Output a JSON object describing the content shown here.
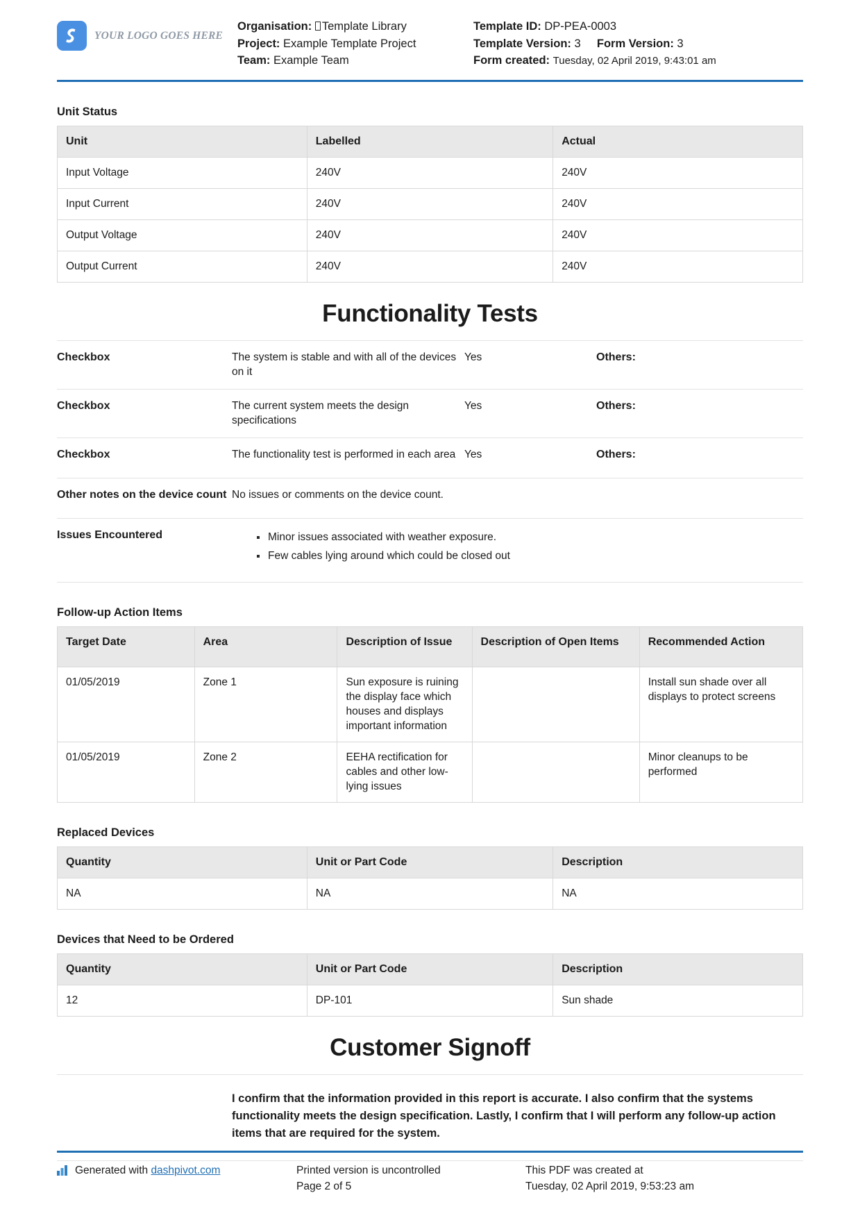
{
  "brand": {
    "accent": "#1f6fb5",
    "logo_blue": "#4a90e2",
    "logo_text": "YOUR LOGO GOES HERE"
  },
  "header": {
    "left": [
      {
        "label": "Organisation:",
        "value": "Template Library",
        "tofu": true
      },
      {
        "label": "Project:",
        "value": "Example Template Project"
      },
      {
        "label": "Team:",
        "value": "Example Team"
      }
    ],
    "right": [
      {
        "label": "Template ID:",
        "value": "DP-PEA-0003"
      },
      {
        "label": "Template Version:",
        "value": "3",
        "label2": "Form Version:",
        "value2": "3"
      },
      {
        "label": "Form created:",
        "value": "Tuesday, 02 April 2019, 9:43:01 am"
      }
    ]
  },
  "unit_status": {
    "section_label": "Unit Status",
    "columns": [
      "Unit",
      "Labelled",
      "Actual"
    ],
    "rows": [
      [
        "Input Voltage",
        "240V",
        "240V"
      ],
      [
        "Input Current",
        "240V",
        "240V"
      ],
      [
        "Output Voltage",
        "240V",
        "240V"
      ],
      [
        "Output Current",
        "240V",
        "240V"
      ]
    ]
  },
  "functionality": {
    "title": "Functionality Tests",
    "checks": [
      {
        "label": "Checkbox",
        "description": "The system is stable and with all of the devices on it",
        "answer": "Yes",
        "others": "Others:"
      },
      {
        "label": "Checkbox",
        "description": "The current system meets the design specifications",
        "answer": "Yes",
        "others": "Others:"
      },
      {
        "label": "Checkbox",
        "description": "The functionality test is performed in each area",
        "answer": "Yes",
        "others": "Others:"
      }
    ],
    "notes": {
      "label": "Other notes on the device count",
      "value": "No issues or comments on the device count."
    },
    "issues": {
      "label": "Issues Encountered",
      "items": [
        "Minor issues associated with weather exposure.",
        "Few cables lying around which could be closed out"
      ]
    }
  },
  "follow_up": {
    "section_label": "Follow-up Action Items",
    "columns": [
      "Target Date",
      "Area",
      "Description of Issue",
      "Description of Open Items",
      "Recommended Action"
    ],
    "rows": [
      [
        "01/05/2019",
        "Zone 1",
        "Sun exposure is ruining the display face which houses and displays important information",
        "",
        "Install sun shade over all displays to protect screens"
      ],
      [
        "01/05/2019",
        "Zone 2",
        "EEHA rectification for cables and other low-lying issues",
        "",
        "Minor cleanups to be performed"
      ]
    ]
  },
  "replaced_devices": {
    "section_label": "Replaced Devices",
    "columns": [
      "Quantity",
      "Unit or Part Code",
      "Description"
    ],
    "rows": [
      [
        "NA",
        "NA",
        "NA"
      ]
    ]
  },
  "devices_ordered": {
    "section_label": "Devices that Need to be Ordered",
    "columns": [
      "Quantity",
      "Unit or Part Code",
      "Description"
    ],
    "rows": [
      [
        "12",
        "DP-101",
        "Sun shade"
      ]
    ]
  },
  "signoff": {
    "title": "Customer Signoff",
    "statement": "I confirm that the information provided in this report is accurate. I also confirm that the systems functionality meets the design specification. Lastly, I confirm that I will perform any follow-up action items that are required for the system."
  },
  "footer": {
    "generated_prefix": "Generated with ",
    "generated_link": "dashpivot.com",
    "print_notice": "Printed version is uncontrolled",
    "page_label": "Page 2 of 5",
    "created_notice": "This PDF was created at",
    "created_time": "Tuesday, 02 April 2019, 9:53:23 am"
  }
}
